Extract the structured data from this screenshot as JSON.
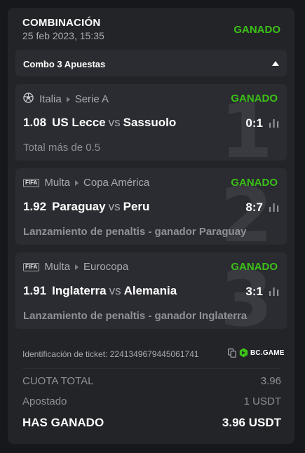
{
  "header": {
    "title": "COMBINACIÓN",
    "date": "25 feb 2023, 15:35",
    "status": "GANADO"
  },
  "combo": {
    "label": "Combo 3 Apuestas",
    "toggle_icon": "caret-up-icon"
  },
  "bets": [
    {
      "index": "1",
      "sport_icon": "soccer-ball-icon",
      "country": "Italia",
      "league": "Serie A",
      "status": "GANADO",
      "odds": "1.08",
      "home": "US Lecce",
      "vs": "vs",
      "away": "Sassuolo",
      "score": "0:1",
      "market": "Total más de 0.5"
    },
    {
      "index": "2",
      "sport_icon": "fifa-icon",
      "sport_icon_text": "FIFA",
      "country": "Multa",
      "league": "Copa América",
      "status": "GANADO",
      "odds": "1.92",
      "home": "Paraguay",
      "vs": "vs",
      "away": "Peru",
      "score": "8:7",
      "market": "Lanzamiento de penaltis - ganador Paraguay"
    },
    {
      "index": "3",
      "sport_icon": "fifa-icon",
      "sport_icon_text": "FIFA",
      "country": "Multa",
      "league": "Eurocopa",
      "status": "GANADO",
      "odds": "1.91",
      "home": "Inglaterra",
      "vs": "vs",
      "away": "Alemania",
      "score": "3:1",
      "market": "Lanzamiento de penaltis - ganador Inglaterra"
    }
  ],
  "ticket": {
    "text": "Identificación de ticket: 2241349679445061741",
    "brand": "BC.GAME"
  },
  "summary": {
    "total_odds_label": "CUOTA TOTAL",
    "total_odds_value": "3.96",
    "staked_label": "Apostado",
    "staked_value": "1 USDT",
    "won_label": "HAS GANADO",
    "won_value": "3.96 USDT"
  },
  "colors": {
    "win": "#3bc117",
    "card": "#232428",
    "panel": "#2b2c31",
    "background": "#17181b"
  }
}
